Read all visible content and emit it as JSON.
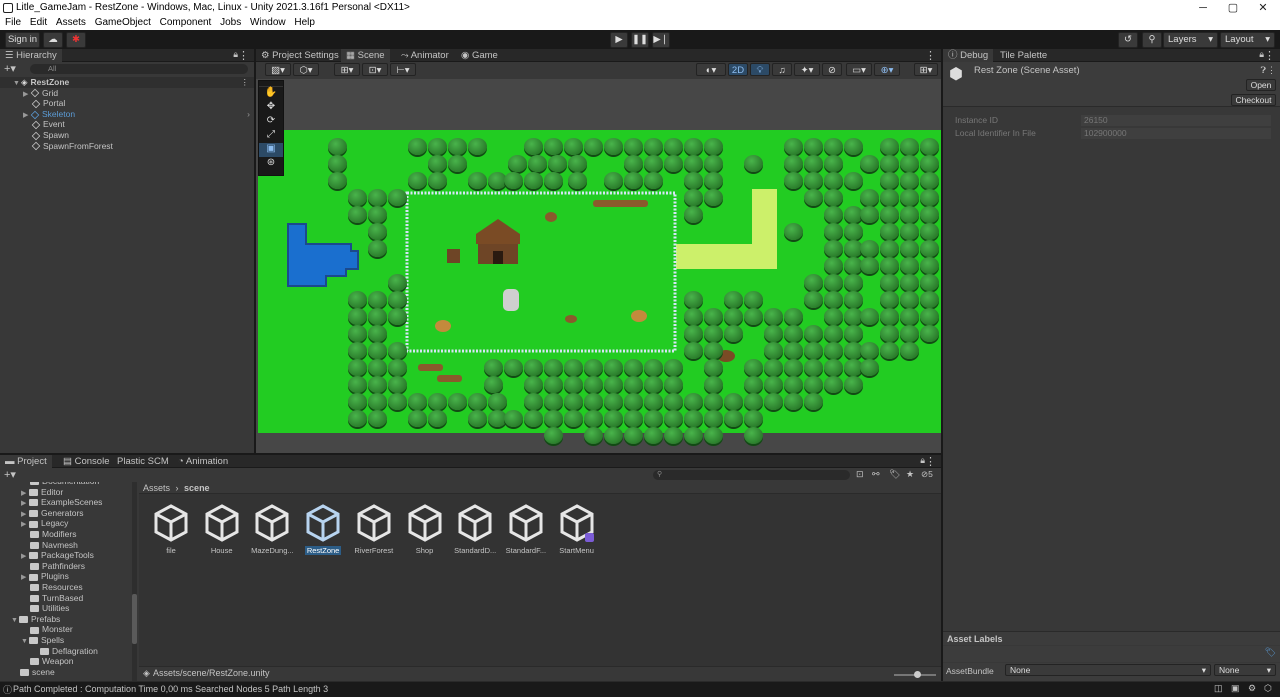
{
  "window": {
    "title": "Litle_GameJam - RestZone - Windows, Mac, Linux - Unity 2021.3.16f1 Personal <DX11>",
    "minimize": "─",
    "maximize": "▢",
    "close": "✕"
  },
  "menu": [
    "File",
    "Edit",
    "Assets",
    "GameObject",
    "Component",
    "Jobs",
    "Window",
    "Help"
  ],
  "toolbar": {
    "sign_in": "Sign in",
    "layers": "Layers",
    "layout": "Layout"
  },
  "hierarchy": {
    "tab": "Hierarchy",
    "search_placeholder": "All",
    "scene": "RestZone",
    "items": [
      "Grid",
      "Portal",
      "Skeleton",
      "Event",
      "Spawn",
      "SpawnFromForest"
    ]
  },
  "center_tabs": [
    "Project Settings",
    "Scene",
    "Animator",
    "Game"
  ],
  "scene_toolbar": {
    "mode2d": "2D"
  },
  "inspector": {
    "tabs": [
      "Debug",
      "Tile Palette"
    ],
    "asset_title": "Rest Zone (Scene Asset)",
    "open": "Open",
    "checkout": "Checkout",
    "fields": [
      {
        "label": "Instance ID",
        "value": "26150"
      },
      {
        "label": "Local Identifier In File",
        "value": "102900000"
      }
    ],
    "asset_labels": "Asset Labels",
    "asset_bundle_label": "AssetBundle",
    "asset_bundle_value": "None",
    "asset_variant_value": "None"
  },
  "bottom_tabs": [
    "Project",
    "Console",
    "Plastic SCM",
    "Animation"
  ],
  "project": {
    "hidden_count": "5",
    "folders": [
      {
        "name": "Documentation",
        "indent": 1,
        "arrow": false
      },
      {
        "name": "Editor",
        "indent": 1,
        "arrow": true
      },
      {
        "name": "ExampleScenes",
        "indent": 1,
        "arrow": true
      },
      {
        "name": "Generators",
        "indent": 1,
        "arrow": true
      },
      {
        "name": "Legacy",
        "indent": 1,
        "arrow": true
      },
      {
        "name": "Modifiers",
        "indent": 1,
        "arrow": false
      },
      {
        "name": "Navmesh",
        "indent": 1,
        "arrow": false
      },
      {
        "name": "PackageTools",
        "indent": 1,
        "arrow": true
      },
      {
        "name": "Pathfinders",
        "indent": 1,
        "arrow": false
      },
      {
        "name": "Plugins",
        "indent": 1,
        "arrow": true
      },
      {
        "name": "Resources",
        "indent": 1,
        "arrow": false
      },
      {
        "name": "TurnBased",
        "indent": 1,
        "arrow": false
      },
      {
        "name": "Utilities",
        "indent": 1,
        "arrow": false
      },
      {
        "name": "Prefabs",
        "indent": 0,
        "arrow": true
      },
      {
        "name": "Monster",
        "indent": 1,
        "arrow": false
      },
      {
        "name": "Spells",
        "indent": 1,
        "arrow": true
      },
      {
        "name": "Deflagration",
        "indent": 2,
        "arrow": false
      },
      {
        "name": "Weapon",
        "indent": 1,
        "arrow": false
      },
      {
        "name": "scene",
        "indent": 0,
        "arrow": false
      }
    ],
    "breadcrumb_root": "Assets",
    "breadcrumb_sep": "›",
    "breadcrumb_current": "scene",
    "assets": [
      "file",
      "House",
      "MazeDung...",
      "RestZone",
      "RiverForest",
      "Shop",
      "StandardD...",
      "StandardF...",
      "StartMenu"
    ],
    "selected_path": "Assets/scene/RestZone.unity"
  },
  "status": "Path Completed : Computation Time 0,00 ms Searched Nodes 5 Path Length 3",
  "colors": {
    "grass": "#22cc22",
    "selection": "#2c5d87",
    "accent": "#4a90d9"
  }
}
